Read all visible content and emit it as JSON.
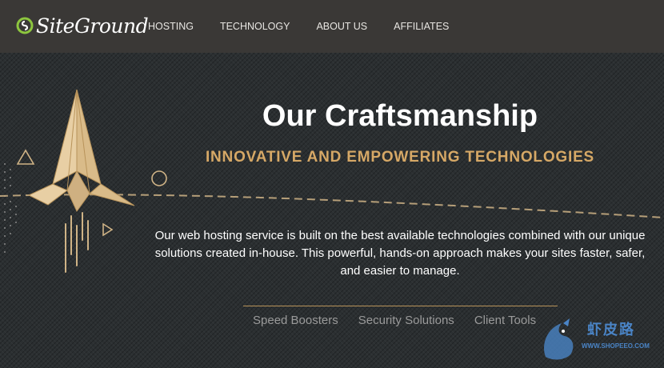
{
  "header": {
    "logo_text": "SiteGround",
    "nav": [
      {
        "label": "HOSTING"
      },
      {
        "label": "TECHNOLOGY"
      },
      {
        "label": "ABOUT US"
      },
      {
        "label": "AFFILIATES"
      }
    ]
  },
  "hero": {
    "title": "Our Craftsmanship",
    "subtitle": "INNOVATIVE AND EMPOWERING TECHNOLOGIES",
    "description": "Our web hosting service is built on the best available technologies combined with our unique solutions created in-house. This powerful, hands-on approach makes your sites faster, safer, and easier to manage.",
    "links": [
      {
        "label": "Speed Boosters"
      },
      {
        "label": "Security Solutions"
      },
      {
        "label": "Client Tools"
      }
    ]
  },
  "watermark": {
    "text": "虾皮路",
    "url": "WWW.SHOPEEO.COM"
  },
  "colors": {
    "nav_bg": "#3a3836",
    "hero_bg": "#2b2f31",
    "accent_gold": "#d6a866",
    "paper": "#e8cfa4",
    "logo_green": "#8dc63f"
  }
}
